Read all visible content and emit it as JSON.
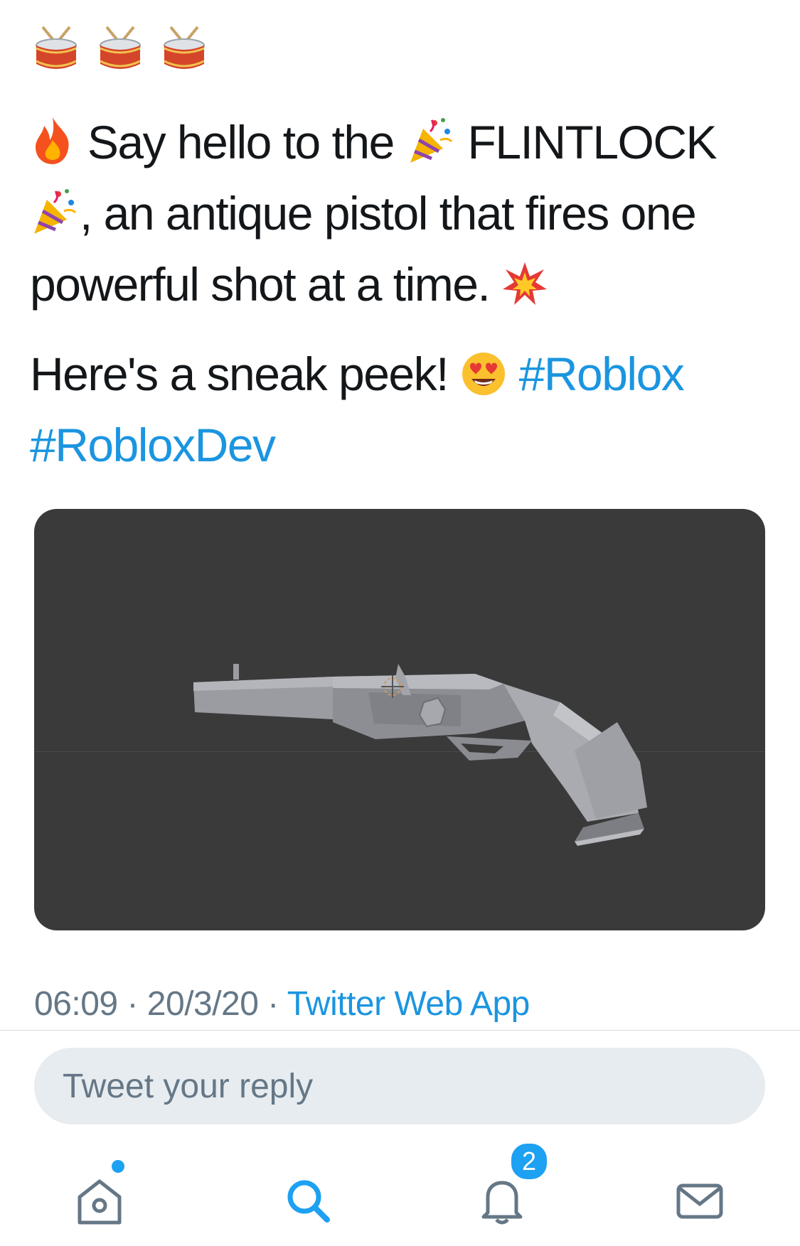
{
  "tweet": {
    "line1_text": "Say hello to the",
    "line1_word": "FLINTLOCK",
    "line2_text": ", an antique pistol that fires one",
    "line3_text": "powerful shot at a time.",
    "para2_text": "Here's a sneak peek!",
    "hashtags": [
      "#Roblox",
      "#RobloxDev"
    ],
    "emojis": [
      "drum",
      "drum",
      "drum",
      "fire",
      "party-popper",
      "party-popper",
      "collision",
      "heart-eyes"
    ]
  },
  "meta": {
    "time": "06:09",
    "date": "20/3/20",
    "separator": "·",
    "source": "Twitter Web App"
  },
  "reply": {
    "placeholder": "Tweet your reply"
  },
  "tabbar": {
    "notifications_badge": "2",
    "items": [
      "home",
      "search",
      "notifications",
      "messages"
    ]
  },
  "colors": {
    "link": "#1b95e0",
    "muted": "#657786",
    "accent": "#1da1f2",
    "media_bg": "#3a3a3a"
  }
}
